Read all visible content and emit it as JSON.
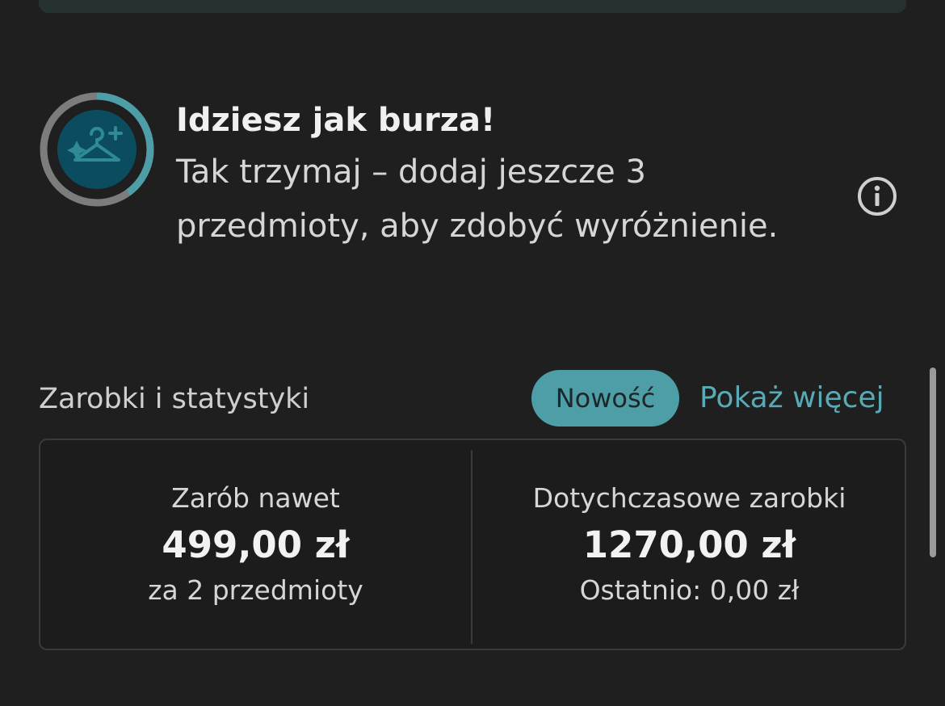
{
  "progress": {
    "title": "Idziesz jak burza!",
    "body": "Tak trzymaj – dodaj jeszcze 3 przedmioty, aby zdobyć wyróżnienie.",
    "fraction_complete": 0.4,
    "badge_icon": "hanger-sparkle-icon",
    "accent_color": "#4e9ea8"
  },
  "stats_section": {
    "title": "Zarobki i statystyki",
    "new_badge": "Nowość",
    "show_more": "Pokaż więcej"
  },
  "stats": {
    "potential": {
      "label": "Zarób nawet",
      "value": "499,00 zł",
      "sub": "za 2 przedmioty"
    },
    "earned": {
      "label": "Dotychczasowe zarobki",
      "value": "1270,00 zł",
      "sub": "Ostatnio: 0,00 zł"
    }
  }
}
